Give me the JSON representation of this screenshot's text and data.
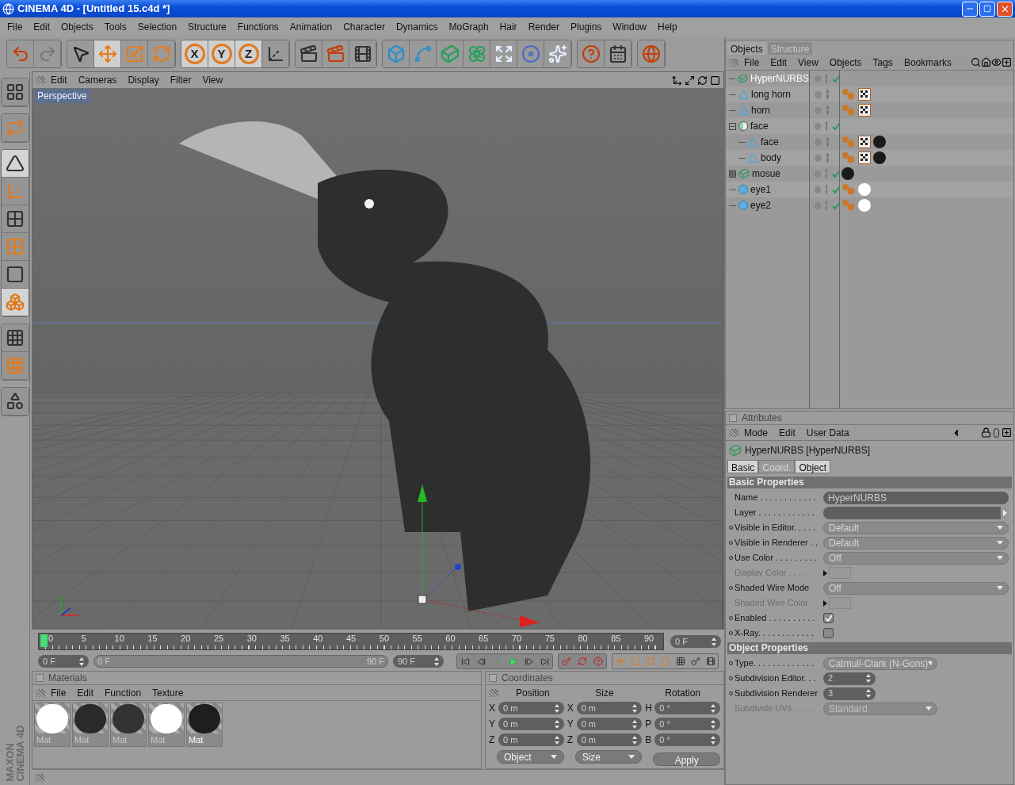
{
  "window": {
    "title": "CINEMA 4D - [Untitled 15.c4d *]"
  },
  "menu": [
    "File",
    "Edit",
    "Objects",
    "Tools",
    "Selection",
    "Structure",
    "Functions",
    "Animation",
    "Character",
    "Dynamics",
    "MoGraph",
    "Hair",
    "Render",
    "Plugins",
    "Window",
    "Help"
  ],
  "toolbar": [
    {
      "selected": false
    },
    {
      "selected": false
    },
    {
      "selected": false
    },
    {
      "selected": true
    },
    {
      "selected": false
    },
    {
      "selected": false
    },
    {
      "label": "X",
      "selected": true
    },
    {
      "label": "Y",
      "selected": true
    },
    {
      "label": "Z",
      "selected": true
    },
    {
      "selected": false
    },
    {
      "selected": false
    },
    {
      "selected": false
    },
    {
      "selected": false
    },
    {
      "selected": false
    },
    {
      "selected": false
    },
    {
      "selected": false
    },
    {
      "selected": false
    },
    {
      "selected": false
    },
    {
      "selected": false
    },
    {
      "selected": false
    },
    {
      "selected": false
    },
    {
      "selected": false
    },
    {
      "selected": false
    }
  ],
  "left_toolbar": [
    {
      "selected": false
    },
    {
      "selected": false
    },
    {
      "selected": true
    },
    {
      "selected": false
    },
    {
      "selected": false
    },
    {
      "selected": false
    },
    {
      "selected": false
    },
    {
      "selected": true
    },
    {
      "selected": false
    },
    {
      "selected": false
    },
    {
      "selected": false
    }
  ],
  "viewport": {
    "menu": [
      "Edit",
      "Cameras",
      "Display",
      "Filter",
      "View"
    ],
    "camera_label": "Perspective"
  },
  "timeline": {
    "ticks": [
      "0",
      "5",
      "10",
      "15",
      "20",
      "25",
      "30",
      "35",
      "40",
      "45",
      "50",
      "55",
      "60",
      "65",
      "70",
      "75",
      "80",
      "85",
      "90"
    ],
    "level": 0,
    "current_frame": "0 F",
    "start_field": "0 F",
    "range_start": "0 F",
    "range_end": "90 F",
    "end_field": "90 F"
  },
  "materials": {
    "title": "Materials",
    "menu": [
      "File",
      "Edit",
      "Function",
      "Texture"
    ],
    "items": [
      {
        "label": "Mat",
        "color": "#ffffff",
        "selected": false
      },
      {
        "label": "Mat",
        "color": "#2a2a2a",
        "selected": false
      },
      {
        "label": "Mat",
        "color": "#333333",
        "selected": false
      },
      {
        "label": "Mat",
        "color": "#ffffff",
        "selected": false
      },
      {
        "label": "Mat",
        "color": "#1e1e1e",
        "selected": true
      }
    ]
  },
  "coordinates": {
    "title": "Coordinates",
    "columns": [
      {
        "heading": "Position",
        "rows": [
          {
            "axis": "X",
            "value": "0 m"
          },
          {
            "axis": "Y",
            "value": "0 m"
          },
          {
            "axis": "Z",
            "value": "0 m"
          }
        ],
        "dropdown": "Object"
      },
      {
        "heading": "Size",
        "rows": [
          {
            "axis": "X",
            "value": "0 m"
          },
          {
            "axis": "Y",
            "value": "0 m"
          },
          {
            "axis": "Z",
            "value": "0 m"
          }
        ],
        "dropdown": "Size"
      },
      {
        "heading": "Rotation",
        "rows": [
          {
            "axis": "H",
            "value": "0 °"
          },
          {
            "axis": "P",
            "value": "0 °"
          },
          {
            "axis": "B",
            "value": "0 °"
          }
        ]
      }
    ],
    "apply": "Apply"
  },
  "objects": {
    "tabs": [
      {
        "label": "Objects",
        "selected": true
      },
      {
        "label": "Structure",
        "selected": false
      }
    ],
    "menu": [
      "File",
      "Edit",
      "View",
      "Objects",
      "Tags",
      "Bookmarks"
    ],
    "tree": [
      {
        "name": "HyperNURBS",
        "kind": "hypernurbs",
        "selected": true,
        "checked": true
      },
      {
        "name": "long horn",
        "kind": "polygon",
        "selected": false,
        "checked": false,
        "tags": [
          {
            "kind": "phong"
          },
          {
            "kind": "texture"
          }
        ]
      },
      {
        "name": "horn",
        "kind": "polygon",
        "selected": false,
        "checked": false,
        "tags": [
          {
            "kind": "phong"
          },
          {
            "kind": "texture"
          }
        ]
      },
      {
        "name": "face",
        "kind": "null",
        "selected": false,
        "checked": true,
        "expanded": true,
        "children": [
          {
            "name": "face",
            "kind": "polygon",
            "selected": false,
            "checked": false,
            "tags": [
              {
                "kind": "phong"
              },
              {
                "kind": "texture"
              },
              {
                "kind": "material",
                "color": "#1a1a1a"
              }
            ]
          },
          {
            "name": "body",
            "kind": "polygon",
            "selected": false,
            "checked": false,
            "tags": [
              {
                "kind": "phong"
              },
              {
                "kind": "texture"
              },
              {
                "kind": "material",
                "color": "#1a1a1a"
              }
            ]
          }
        ]
      },
      {
        "name": "mosue",
        "kind": "hypernurbs",
        "selected": false,
        "checked": true,
        "expanded": false,
        "tags": [
          {
            "kind": "material",
            "color": "#1a1a1a"
          }
        ]
      },
      {
        "name": "eye1",
        "kind": "sphere",
        "selected": false,
        "checked": true,
        "tags": [
          {
            "kind": "phong"
          },
          {
            "kind": "material",
            "color": "#ffffff"
          }
        ]
      },
      {
        "name": "eye2",
        "kind": "sphere",
        "selected": false,
        "checked": true,
        "tags": [
          {
            "kind": "phong"
          },
          {
            "kind": "material",
            "color": "#ffffff"
          }
        ]
      }
    ]
  },
  "attributes": {
    "title": "Attributes",
    "menu": [
      "Mode",
      "Edit",
      "User Data"
    ],
    "object_title": "HyperNURBS [HyperNURBS]",
    "tabs": [
      {
        "label": "Basic",
        "selected": true
      },
      {
        "label": "Coord.",
        "selected": false
      },
      {
        "label": "Object",
        "selected": true
      }
    ],
    "sections": [
      {
        "title": "Basic Properties",
        "rows": [
          {
            "label": "Name . . . . . . . . . . . .",
            "kind": "text",
            "value": "HyperNURBS",
            "animatable": false,
            "disabled": false
          },
          {
            "label": "Layer . . . . . . . . . . . .",
            "kind": "layer",
            "animatable": false,
            "disabled": false
          },
          {
            "label": "Visible in Editor. . . . .",
            "kind": "dropdown",
            "value": "Default",
            "animatable": true,
            "disabled": false
          },
          {
            "label": "Visible in Renderer . .",
            "kind": "dropdown",
            "value": "Default",
            "animatable": true,
            "disabled": false
          },
          {
            "label": "Use Color . . . . . . . . .",
            "kind": "dropdown",
            "value": "Off",
            "animatable": true,
            "disabled": false
          },
          {
            "label": "Display Color . . . .",
            "kind": "color",
            "animatable": false,
            "disabled": true
          },
          {
            "label": "Shaded Wire Mode",
            "kind": "dropdown",
            "value": "Off",
            "animatable": true,
            "disabled": false
          },
          {
            "label": "Shaded Wire Color",
            "kind": "color",
            "animatable": false,
            "disabled": true
          },
          {
            "label": "Enabled . . . . . . . . . .",
            "kind": "checkbox",
            "checked": true,
            "animatable": true,
            "disabled": false
          },
          {
            "label": "X-Ray. . . . . . . . . . . .",
            "kind": "checkbox",
            "checked": false,
            "animatable": true,
            "disabled": false
          }
        ]
      },
      {
        "title": "Object Properties",
        "rows": [
          {
            "label": "Type. . . . . . . . . . . . .",
            "kind": "dropdown-short",
            "value": "Catmull-Clark (N-Gons)",
            "animatable": true,
            "disabled": false
          },
          {
            "label": "Subdivision Editor. . .",
            "kind": "spinner",
            "value": "2",
            "animatable": true,
            "disabled": false
          },
          {
            "label": "Subdivision Renderer",
            "kind": "spinner",
            "value": "3",
            "animatable": true,
            "disabled": false
          },
          {
            "label": "Subdivide UVs . . . . .",
            "kind": "dropdown-short",
            "value": "Standard",
            "animatable": false,
            "disabled": true
          }
        ]
      }
    ]
  },
  "logo": {
    "line1": "MAXON",
    "line2": "CINEMA 4D"
  }
}
